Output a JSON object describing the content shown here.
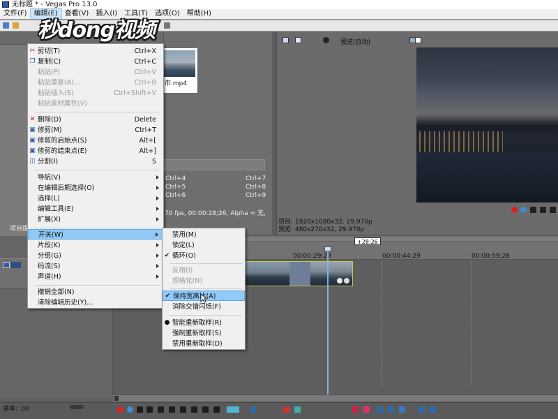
{
  "window": {
    "title": "无标题 * - Vegas Pro 13.0"
  },
  "watermark": {
    "text": "秒dong视频"
  },
  "menubar": [
    {
      "label": "文件(F)"
    },
    {
      "label": "编辑(E)"
    },
    {
      "label": "查看(V)"
    },
    {
      "label": "插入(I)"
    },
    {
      "label": "工具(T)"
    },
    {
      "label": "选项(O)"
    },
    {
      "label": "帮助(H)"
    }
  ],
  "edit_menu": {
    "items": [
      {
        "label": "剪切(T)",
        "shortcut": "Ctrl+X",
        "icon": "scissors-icon"
      },
      {
        "label": "复制(C)",
        "shortcut": "Ctrl+C",
        "icon": "copy-icon"
      },
      {
        "label": "粘贴(P)",
        "shortcut": "Ctrl+V",
        "disabled": true
      },
      {
        "label": "粘贴重复(A)...",
        "shortcut": "Ctrl+B",
        "disabled": true
      },
      {
        "label": "粘贴插入(S)",
        "shortcut": "Ctrl+Shift+V",
        "disabled": true
      },
      {
        "label": "粘贴素材属性(V)",
        "shortcut": "",
        "disabled": true
      },
      {
        "label": "删除(D)",
        "shortcut": "Delete",
        "icon": "delete-x-icon"
      },
      {
        "label": "修剪(M)",
        "shortcut": "Ctrl+T",
        "icon": "trim-icon"
      },
      {
        "label": "修剪的启始点(S)",
        "shortcut": "Alt+[",
        "icon": "trim-start-icon"
      },
      {
        "label": "修剪的结束点(E)",
        "shortcut": "Alt+]",
        "icon": "trim-end-icon"
      },
      {
        "label": "分割(I)",
        "shortcut": "S",
        "icon": "split-icon"
      },
      {
        "label": "导航(V)",
        "submenu": true
      },
      {
        "label": "在编辑后期选择(O)",
        "submenu": true
      },
      {
        "label": "选择(L)",
        "submenu": true
      },
      {
        "label": "编辑工具(E)",
        "submenu": true
      },
      {
        "label": "扩展(X)",
        "submenu": true
      },
      {
        "label": "开关(W)",
        "submenu": true,
        "highlighted": true
      },
      {
        "label": "片段(K)",
        "submenu": true
      },
      {
        "label": "分组(G)",
        "submenu": true
      },
      {
        "label": "码流(S)",
        "submenu": true
      },
      {
        "label": "声道(H)",
        "submenu": true
      },
      {
        "label": "撤销全部(N)"
      },
      {
        "label": "清除编辑历史(Y)..."
      }
    ]
  },
  "switches_menu": {
    "items": [
      {
        "label": "禁用(M)"
      },
      {
        "label": "锁定(L)"
      },
      {
        "label": "循环(O)",
        "checked": true
      },
      {
        "label": "反相(I)",
        "disabled": true
      },
      {
        "label": "规格化(N)",
        "disabled": true
      },
      {
        "label": "保持宽高比(A)",
        "checked": true,
        "highlighted": true
      },
      {
        "label": "消除交错闪烁(F)"
      },
      {
        "label": "智能重新取样(R)",
        "radio": true
      },
      {
        "label": "强制重新取样(S)"
      },
      {
        "label": "禁用重新取样(D)"
      }
    ]
  },
  "media": {
    "file_name": "市.mp4",
    "shortcuts_left": [
      "Ctrl+4",
      "Ctrl+5",
      "Ctrl+6"
    ],
    "shortcuts_right": [
      "Ctrl+7",
      "Ctrl+8",
      "Ctrl+9"
    ],
    "properties": "70 fps,  00:00:28;26,  Alpha = 无,"
  },
  "explorer": {
    "tab_label": "项目媒"
  },
  "preview": {
    "mode_label": "预览(自动)",
    "project_info": "项目: 1920x1080x32, 29.970p",
    "preview_info": "预览: 480x270x32, 29.970p"
  },
  "timeline": {
    "ticks": [
      "00:00:29;29",
      "00:00:44;29",
      "00:00:59;28"
    ],
    "timecode_badge": "+28:26",
    "rate_label": "速率: .00"
  },
  "colors": {
    "highlight": "#91c9f7",
    "menu_bg": "#f0f0f0",
    "clip_border": "#c8c850",
    "playhead": "#7fb2e3"
  }
}
